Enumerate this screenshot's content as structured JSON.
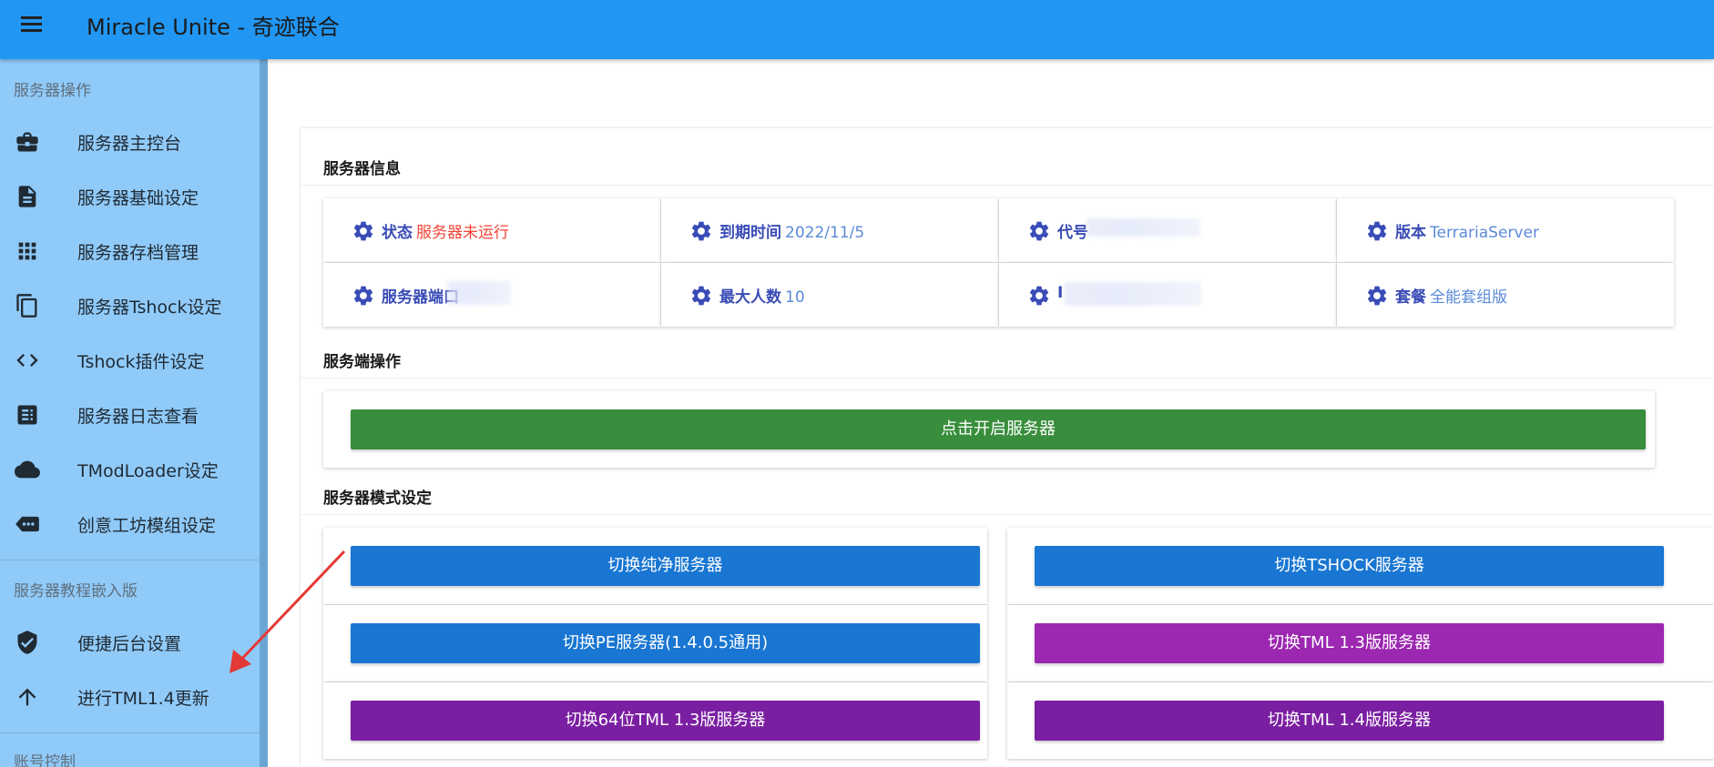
{
  "app": {
    "title": "Miracle Unite - 奇迹联合"
  },
  "sidebar": {
    "sections": [
      {
        "title": "服务器操作"
      },
      {
        "title": "服务器教程嵌入版"
      },
      {
        "title": "账号控制"
      }
    ],
    "items": [
      {
        "label": "服务器主控台",
        "icon": "briefcase-icon"
      },
      {
        "label": "服务器基础设定",
        "icon": "document-icon"
      },
      {
        "label": "服务器存档管理",
        "icon": "grid-icon"
      },
      {
        "label": "服务器Tshock设定",
        "icon": "copy-icon"
      },
      {
        "label": "Tshock插件设定",
        "icon": "code-icon"
      },
      {
        "label": "服务器日志查看",
        "icon": "log-icon"
      },
      {
        "label": "TModLoader设定",
        "icon": "cloud-icon"
      },
      {
        "label": "创意工坊模组设定",
        "icon": "tag-icon"
      },
      {
        "label": "便捷后台设置",
        "icon": "verified-icon"
      },
      {
        "label": "进行TML1.4更新",
        "icon": "arrow-up-icon"
      }
    ]
  },
  "server_info": {
    "title": "服务器信息",
    "cells": [
      {
        "key": "状态",
        "value": "服务器未运行",
        "value_color": "#f44336"
      },
      {
        "key": "到期时间",
        "value": "2022/11/5"
      },
      {
        "key": "代号",
        "value": ""
      },
      {
        "key": "版本",
        "value": "TerrariaServer"
      },
      {
        "key": "服务器端口",
        "value": ""
      },
      {
        "key": "最大人数",
        "value": "10"
      },
      {
        "key": "I",
        "value": ""
      },
      {
        "key": "套餐",
        "value": "全能套组版"
      }
    ]
  },
  "server_ops": {
    "title": "服务端操作",
    "start_label": "点击开启服务器"
  },
  "server_mode": {
    "title": "服务器模式设定",
    "buttons": [
      {
        "label": "切换纯净服务器",
        "color": "#1976d2"
      },
      {
        "label": "切换TSHOCK服务器",
        "color": "#1976d2"
      },
      {
        "label": "切换PE服务器(1.4.0.5通用)",
        "color": "#1976d2"
      },
      {
        "label": "切换TML 1.3版服务器",
        "color": "#9c27b0"
      },
      {
        "label": "切换64位TML 1.3版服务器",
        "color": "#7b1fa2"
      },
      {
        "label": "切换TML 1.4版服务器",
        "color": "#7b1fa2"
      }
    ]
  },
  "colors": {
    "appbar": "#2196f3",
    "sidebar": "#90caf9",
    "start_button": "#388e3c",
    "info_key": "#3a4cb6",
    "info_value": "#5b8ad8",
    "arrow": "#e53935"
  }
}
